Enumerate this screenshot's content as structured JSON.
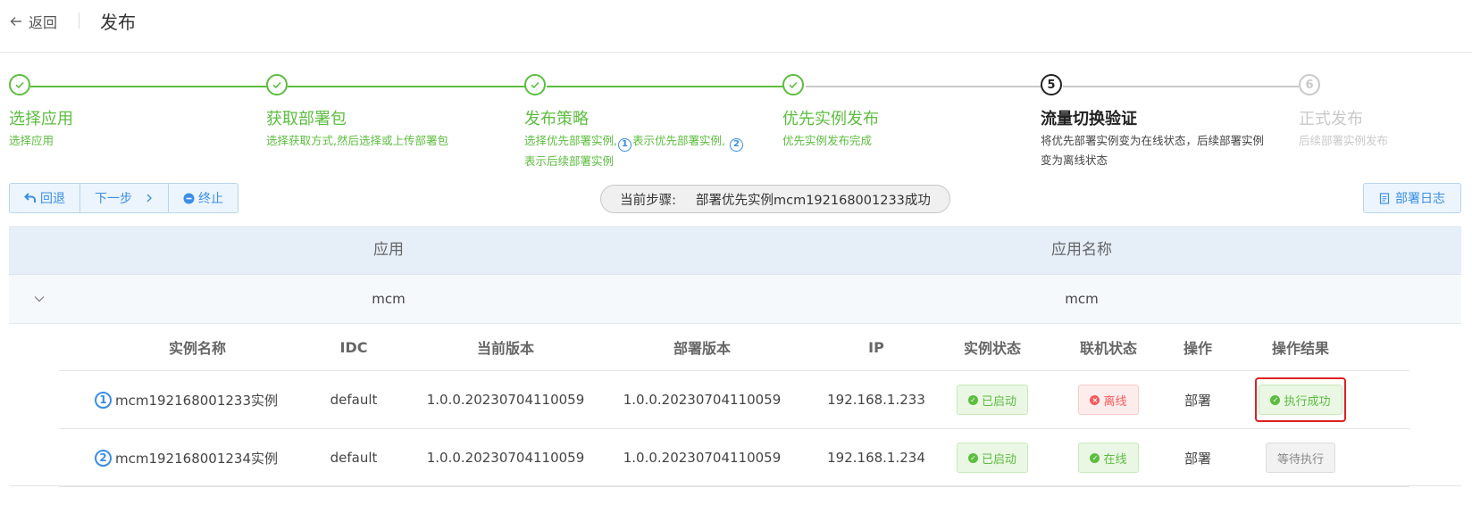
{
  "header": {
    "back_label": "返回",
    "title": "发布"
  },
  "steps": [
    {
      "index": "1",
      "title": "选择应用",
      "desc_lines": [
        "选择应用"
      ],
      "status": "done"
    },
    {
      "index": "2",
      "title": "获取部署包",
      "desc_lines": [
        "选择获取方式,然后选择或上传部署包"
      ],
      "status": "done"
    },
    {
      "index": "3",
      "title": "发布策略",
      "desc_parts": [
        "选择优先部署实例,",
        "1",
        "表示优先部署实例,",
        "2"
      ],
      "desc_line2": "表示后续部署实例",
      "status": "done"
    },
    {
      "index": "4",
      "title": "优先实例发布",
      "desc_lines": [
        "优先实例发布完成"
      ],
      "status": "done"
    },
    {
      "index": "5",
      "title": "流量切换验证",
      "desc_lines": [
        "将优先部署实例变为在线状态，后续部署实例",
        "变为离线状态"
      ],
      "status": "current"
    },
    {
      "index": "6",
      "title": "正式发布",
      "desc_lines": [
        "后续部署实例发布"
      ],
      "status": "wait"
    }
  ],
  "toolbar": {
    "rollback_label": "回退",
    "next_label": "下一步",
    "stop_label": "终止",
    "current_step_label": "当前步骤:",
    "current_step_value": "部署优先实例mcm192168001233成功",
    "log_label": "部署日志"
  },
  "outer_table": {
    "headers": [
      "应用",
      "应用名称"
    ],
    "row": {
      "app": "mcm",
      "app_name": "mcm"
    }
  },
  "inner_table": {
    "headers": [
      "实例名称",
      "IDC",
      "当前版本",
      "部署版本",
      "IP",
      "实例状态",
      "联机状态",
      "操作",
      "操作结果"
    ],
    "rows": [
      {
        "num": "1",
        "name": "mcm192168001233实例",
        "idc": "default",
        "current_version": "1.0.0.20230704110059",
        "deploy_version": "1.0.0.20230704110059",
        "ip": "192.168.1.233",
        "instance_status": "已启动",
        "online_status": "离线",
        "action": "部署",
        "result": "执行成功"
      },
      {
        "num": "2",
        "name": "mcm192168001234实例",
        "idc": "default",
        "current_version": "1.0.0.20230704110059",
        "deploy_version": "1.0.0.20230704110059",
        "ip": "192.168.1.234",
        "instance_status": "已启动",
        "online_status": "在线",
        "action": "部署",
        "result": "等待执行"
      }
    ]
  },
  "colors": {
    "done": "#5cbd3f",
    "current": "#222222",
    "wait": "#c9c9c9",
    "accent": "#3a8ee6",
    "error": "#f25c5c",
    "highlight": "#e02020"
  }
}
